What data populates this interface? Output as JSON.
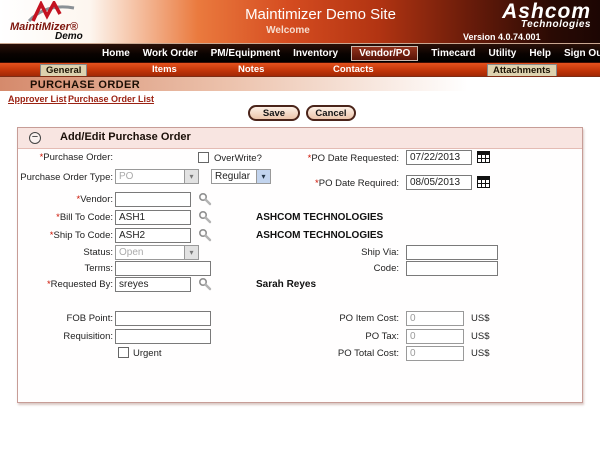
{
  "header": {
    "brand": "MaintiMizer®",
    "brand_sub": "Demo",
    "title": "Maintimizer Demo Site",
    "welcome": "Welcome",
    "ashcom_name": "Ashcom",
    "ashcom_sub": "Technologies",
    "version": "Version 4.0.74.001"
  },
  "nav": {
    "items": [
      {
        "label": "Home"
      },
      {
        "label": "Work Order"
      },
      {
        "label": "PM/Equipment"
      },
      {
        "label": "Inventory"
      },
      {
        "label": "Vendor/PO"
      },
      {
        "label": "Timecard"
      },
      {
        "label": "Utility"
      },
      {
        "label": "Help"
      },
      {
        "label": "Sign Out"
      }
    ]
  },
  "subnav": {
    "items": [
      {
        "label": "General"
      },
      {
        "label": "Items"
      },
      {
        "label": "Notes"
      },
      {
        "label": "Contacts"
      },
      {
        "label": "Attachments"
      }
    ]
  },
  "page": {
    "title": "PURCHASE ORDER",
    "links": [
      {
        "label": "Approver List"
      },
      {
        "label": "Purchase Order List"
      }
    ],
    "save_label": "Save",
    "cancel_label": "Cancel"
  },
  "panel": {
    "collapse_glyph": "−",
    "title": "Add/Edit Purchase Order"
  },
  "form": {
    "req_mark": "*",
    "labels": {
      "purchase_order": "Purchase Order:",
      "overwrite": "OverWrite?",
      "po_type": "Purchase Order Type:",
      "vendor": "Vendor:",
      "bill_to": "Bill To Code:",
      "ship_to": "Ship To Code:",
      "status": "Status:",
      "terms": "Terms:",
      "requested_by": "Requested By:",
      "fob_point": "FOB Point:",
      "requisition": "Requisition:",
      "urgent": "Urgent",
      "po_date_requested": "PO Date Requested:",
      "po_date_required": "PO Date Required:",
      "ship_via": "Ship Via:",
      "code": "Code:",
      "po_item_cost": "PO Item Cost:",
      "po_tax": "PO Tax:",
      "po_total_cost": "PO Total Cost:",
      "currency": "US$",
      "select_arrow": "▾"
    },
    "values": {
      "po_type": "PO",
      "po_subtype": "Regular",
      "vendor": "",
      "bill_to": "ASH1",
      "ship_to": "ASH2",
      "status": "Open",
      "terms": "",
      "requested_by": "sreyes",
      "bill_to_name": "ASHCOM TECHNOLOGIES",
      "ship_to_name": "ASHCOM TECHNOLOGIES",
      "requested_by_name": "Sarah Reyes",
      "po_date_requested": "07/22/2013",
      "po_date_required": "08/05/2013",
      "fob_point": "",
      "requisition": "",
      "ship_via": "",
      "code": "",
      "po_item_cost": "0",
      "po_tax": "0",
      "po_total_cost": "0"
    }
  },
  "colors": {
    "accent_orange": "#d54c20",
    "nav_black": "#0a0301",
    "subnav_red": "#c03408",
    "link_red": "#9b2213",
    "panel_border": "#c79d97",
    "panel_header_bg": "#f8e5e1",
    "required_red": "#cc1100"
  }
}
